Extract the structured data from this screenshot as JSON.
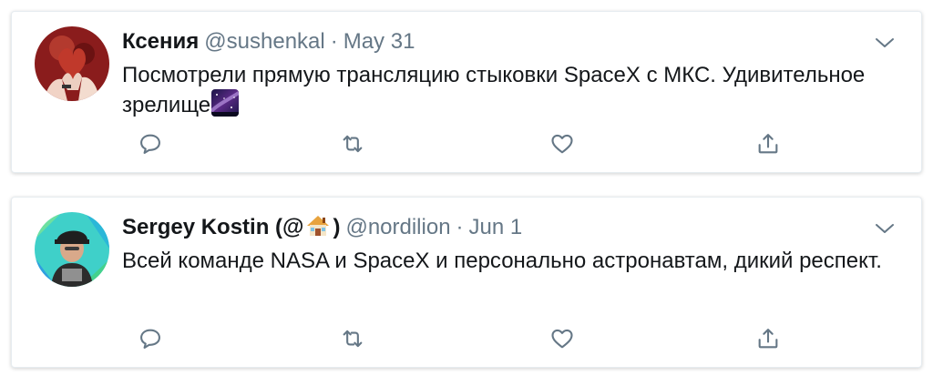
{
  "colors": {
    "secondary_text": "#657786",
    "primary_text": "#14171a",
    "icon": "#657786",
    "border": "#e6ecf0"
  },
  "tweets": [
    {
      "name": "Ксения",
      "handle": "@sushenkal",
      "separator": "·",
      "date": "May 31",
      "text": "Посмотрели прямую трансляцию стыковки SpaceX с МКС. Удивительное зрелище",
      "emoji": "milky-way-icon",
      "actions": [
        "reply-icon",
        "retweet-icon",
        "like-icon",
        "share-icon"
      ]
    },
    {
      "name": "Sergey Kostin (@",
      "name_suffix": ")",
      "name_emoji": "house-icon",
      "handle": "@nordilion",
      "separator": "·",
      "date": "Jun 1",
      "text": "Всей команде NASA и SpaceX и персонально астронавтам, дикий респект.",
      "actions": [
        "reply-icon",
        "retweet-icon",
        "like-icon",
        "share-icon"
      ]
    }
  ]
}
